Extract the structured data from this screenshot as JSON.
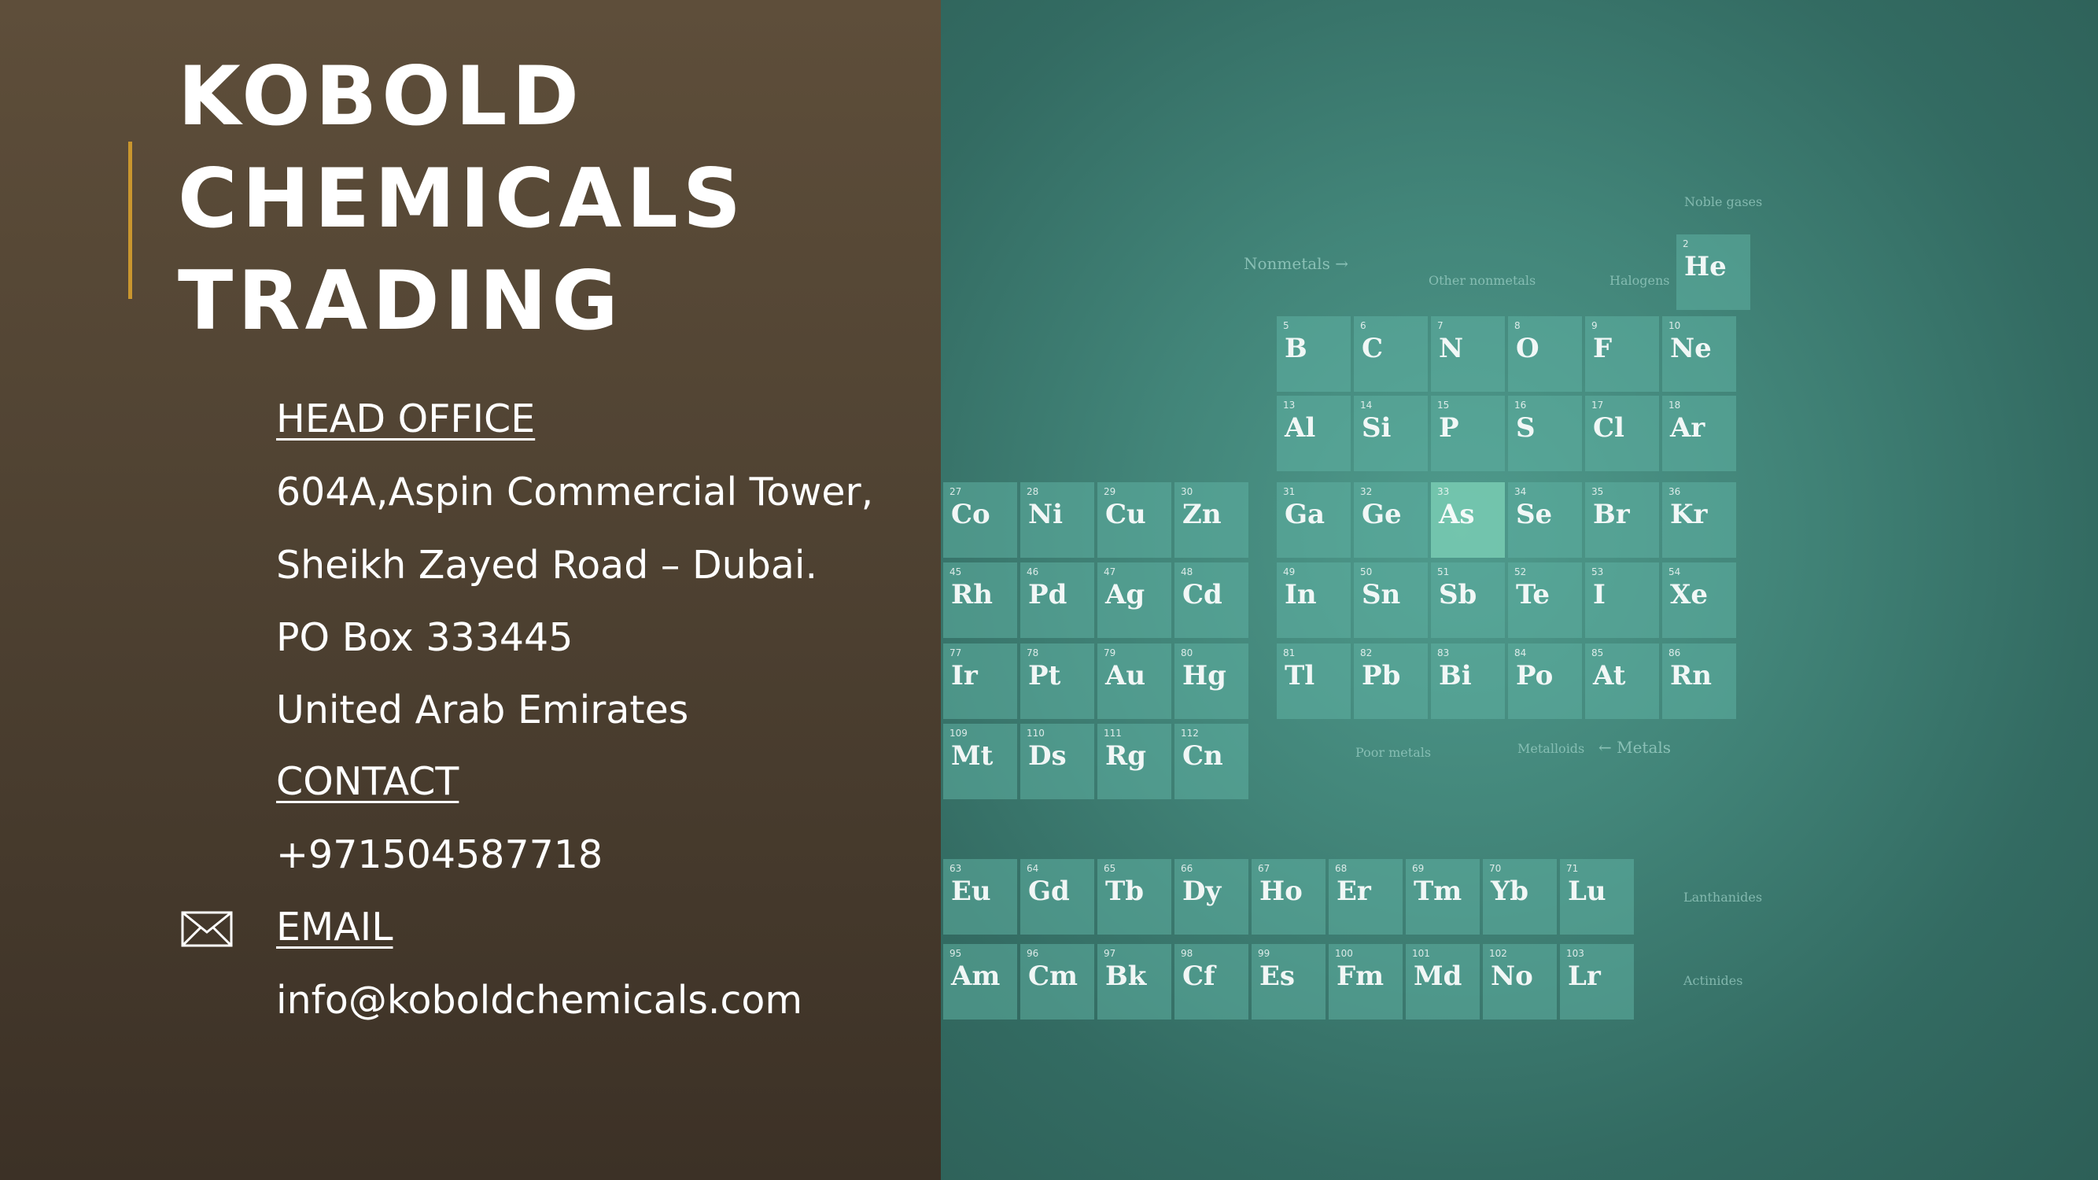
{
  "company": {
    "title_lines": [
      "KOBOLD",
      "CHEMICALS",
      "TRADING"
    ]
  },
  "head_office": {
    "heading": "HEAD OFFICE",
    "lines": [
      "604A,Aspin Commercial Tower,",
      "Sheikh Zayed Road – Dubai.",
      "PO Box 333445",
      "United Arab Emirates"
    ]
  },
  "contact": {
    "heading": "CONTACT",
    "phone": "+971504587718",
    "email_heading": "EMAIL",
    "email": "info@koboldchemicals.com",
    "email_icon": "envelope-icon"
  },
  "periodic_table_image": {
    "group_labels": {
      "noble_gases": "Noble gases",
      "nonmetals": "Nonmetals →",
      "other_nonmetals": "Other nonmetals",
      "halogens": "Halogens",
      "poor_metals": "Poor metals",
      "metalloids": "Metalloids",
      "metals": "← Metals",
      "lanthanides": "Lanthanides",
      "actinides": "Actinides"
    },
    "rows": [
      [
        {
          "n": "2",
          "s": "He"
        }
      ],
      [
        {
          "n": "5",
          "s": "B"
        },
        {
          "n": "6",
          "s": "C"
        },
        {
          "n": "7",
          "s": "N"
        },
        {
          "n": "8",
          "s": "O"
        },
        {
          "n": "9",
          "s": "F"
        },
        {
          "n": "10",
          "s": "Ne"
        }
      ],
      [
        {
          "n": "13",
          "s": "Al"
        },
        {
          "n": "14",
          "s": "Si"
        },
        {
          "n": "15",
          "s": "P"
        },
        {
          "n": "16",
          "s": "S"
        },
        {
          "n": "17",
          "s": "Cl"
        },
        {
          "n": "18",
          "s": "Ar"
        }
      ],
      [
        {
          "n": "27",
          "s": "Co"
        },
        {
          "n": "28",
          "s": "Ni"
        },
        {
          "n": "29",
          "s": "Cu"
        },
        {
          "n": "30",
          "s": "Zn"
        },
        {
          "n": "31",
          "s": "Ga"
        },
        {
          "n": "32",
          "s": "Ge"
        },
        {
          "n": "33",
          "s": "As"
        },
        {
          "n": "34",
          "s": "Se"
        },
        {
          "n": "35",
          "s": "Br"
        },
        {
          "n": "36",
          "s": "Kr"
        }
      ],
      [
        {
          "n": "45",
          "s": "Rh"
        },
        {
          "n": "46",
          "s": "Pd"
        },
        {
          "n": "47",
          "s": "Ag"
        },
        {
          "n": "48",
          "s": "Cd"
        },
        {
          "n": "49",
          "s": "In"
        },
        {
          "n": "50",
          "s": "Sn"
        },
        {
          "n": "51",
          "s": "Sb"
        },
        {
          "n": "52",
          "s": "Te"
        },
        {
          "n": "53",
          "s": "I"
        },
        {
          "n": "54",
          "s": "Xe"
        }
      ],
      [
        {
          "n": "77",
          "s": "Ir"
        },
        {
          "n": "78",
          "s": "Pt"
        },
        {
          "n": "79",
          "s": "Au"
        },
        {
          "n": "80",
          "s": "Hg"
        },
        {
          "n": "81",
          "s": "Tl"
        },
        {
          "n": "82",
          "s": "Pb"
        },
        {
          "n": "83",
          "s": "Bi"
        },
        {
          "n": "84",
          "s": "Po"
        },
        {
          "n": "85",
          "s": "At"
        },
        {
          "n": "86",
          "s": "Rn"
        }
      ],
      [
        {
          "n": "109",
          "s": "Mt"
        },
        {
          "n": "110",
          "s": "Ds"
        },
        {
          "n": "111",
          "s": "Rg"
        },
        {
          "n": "112",
          "s": "Cn"
        }
      ],
      [
        {
          "n": "63",
          "s": "Eu"
        },
        {
          "n": "64",
          "s": "Gd"
        },
        {
          "n": "65",
          "s": "Tb"
        },
        {
          "n": "66",
          "s": "Dy"
        },
        {
          "n": "67",
          "s": "Ho"
        },
        {
          "n": "68",
          "s": "Er"
        },
        {
          "n": "69",
          "s": "Tm"
        },
        {
          "n": "70",
          "s": "Yb"
        },
        {
          "n": "71",
          "s": "Lu"
        }
      ],
      [
        {
          "n": "95",
          "s": "Am"
        },
        {
          "n": "96",
          "s": "Cm"
        },
        {
          "n": "97",
          "s": "Bk"
        },
        {
          "n": "98",
          "s": "Cf"
        },
        {
          "n": "99",
          "s": "Es"
        },
        {
          "n": "100",
          "s": "Fm"
        },
        {
          "n": "101",
          "s": "Md"
        },
        {
          "n": "102",
          "s": "No"
        },
        {
          "n": "103",
          "s": "Lr"
        }
      ]
    ]
  },
  "colors": {
    "accent": "#c9962e",
    "left_panel": "#4f4232",
    "right_panel": "#428579"
  }
}
